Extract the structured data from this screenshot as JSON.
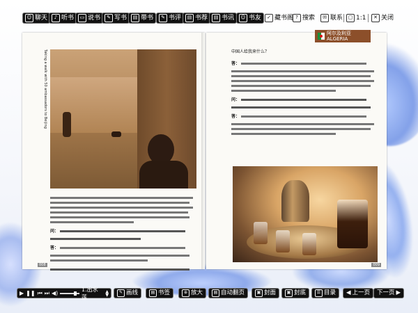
{
  "toolbar": {
    "chat": "聊天",
    "listen": "听书",
    "talk": "说书",
    "write": "写书",
    "bring": "带书",
    "review": "书评",
    "recommend": "书荐",
    "news": "书讯",
    "friends": "书友",
    "stack": "藏书阁",
    "search": "搜索",
    "contact": "联系",
    "ratio": "1:1",
    "close": "关闭"
  },
  "book": {
    "country_cn": "阿尔及利亚",
    "country_en": "ALGERIA",
    "vertical_label": "Taking a walk with 50 ambassadors to Beijing",
    "left_page_number": "008",
    "right_page_number": "009",
    "right_top_line": "中国人给我来什么？",
    "q_marker": "问：",
    "a_marker": "答："
  },
  "bottom": {
    "track": "1.出水莲",
    "draw": "画线",
    "bookmark": "书签",
    "zoom": "放大",
    "autoflip": "自动翻页",
    "cover": "封面",
    "backcover": "封底",
    "contents": "目录",
    "prev": "上一页",
    "next": "下一页"
  }
}
